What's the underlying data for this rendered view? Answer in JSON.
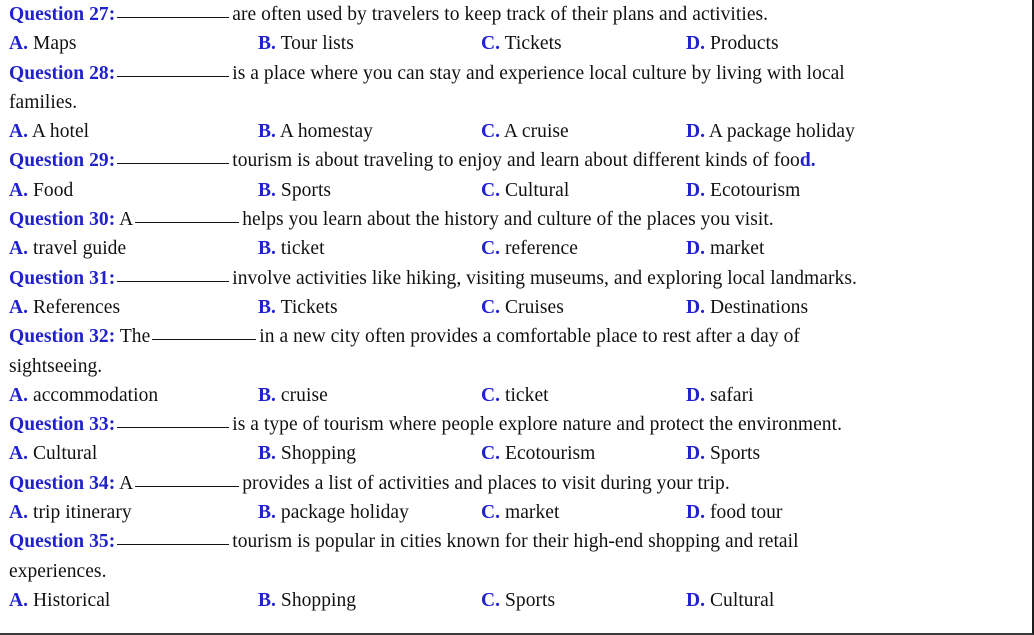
{
  "document": {
    "option_columns": [
      "A.",
      "B.",
      "C.",
      "D."
    ],
    "blank_placeholder": "__________",
    "accent_color": "#2222cc",
    "text_color": "#111111",
    "background_color": "#ffffff"
  },
  "questions": [
    {
      "label": "Question 27:",
      "stem_before": "",
      "stem_after": "are often used by travelers to keep track of their plans and activities.",
      "continuation": "",
      "options": [
        "Maps",
        "Tour lists",
        "Tickets",
        "Products"
      ]
    },
    {
      "label": "Question 28:",
      "stem_before": "",
      "stem_after": "is a place where you can stay and experience local culture by living with local",
      "continuation": "families.",
      "options": [
        "A hotel",
        "A homestay",
        "A cruise",
        "A package holiday"
      ]
    },
    {
      "label": "Question 29:",
      "stem_before": "",
      "stem_after": "tourism is about traveling to enjoy and learn about different kinds of foo",
      "stem_trailing_accent": "d.",
      "continuation": "",
      "options": [
        "Food",
        "Sports",
        "Cultural",
        "Ecotourism"
      ]
    },
    {
      "label": "Question 30:",
      "stem_before": "A",
      "stem_after": "helps you learn about the history and culture of the places you visit.",
      "continuation": "",
      "options": [
        "travel guide",
        "ticket",
        "reference",
        "market"
      ]
    },
    {
      "label": "Question 31:",
      "stem_before": "",
      "stem_after": "involve activities like hiking, visiting museums, and exploring local landmarks.",
      "continuation": "",
      "options": [
        "References",
        "Tickets",
        "Cruises",
        "Destinations"
      ]
    },
    {
      "label": "Question 32:",
      "stem_before": "The",
      "stem_after": "in a new city often provides a comfortable place to rest after a day of",
      "continuation": "sightseeing.",
      "options": [
        "accommodation",
        "cruise",
        "ticket",
        "safari"
      ]
    },
    {
      "label": "Question 33:",
      "stem_before": "",
      "stem_after": "is a type of tourism where people explore nature and protect the environment.",
      "continuation": "",
      "options": [
        "Cultural",
        "Shopping",
        "Ecotourism",
        "Sports"
      ]
    },
    {
      "label": "Question 34:",
      "stem_before": "A",
      "stem_after": "provides a list of activities and places to visit during your trip.",
      "continuation": "",
      "options": [
        "trip itinerary",
        "package holiday",
        "market",
        "food tour"
      ]
    },
    {
      "label": "Question 35:",
      "stem_before": "",
      "stem_after": "tourism is popular in cities known for their high-end shopping and retail",
      "continuation": "experiences.",
      "options": [
        "Historical",
        "Shopping",
        "Sports",
        "Cultural"
      ]
    }
  ]
}
